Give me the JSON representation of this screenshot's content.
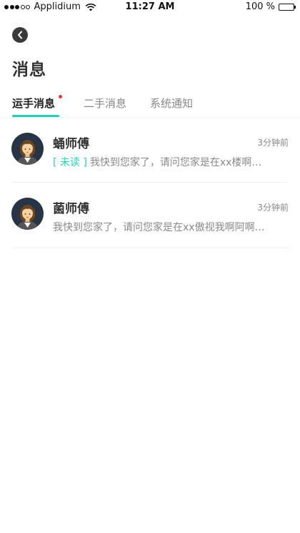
{
  "status_bar": {
    "carrier": "Applidium",
    "time": "11:27 AM",
    "battery": "100 %"
  },
  "page": {
    "title": "消息"
  },
  "tabs": [
    {
      "label": "运手消息",
      "active": true,
      "badge": true
    },
    {
      "label": "二手消息",
      "active": false
    },
    {
      "label": "系统通知",
      "active": false
    }
  ],
  "messages": [
    {
      "name": "蛹师傅",
      "time": "3分钟前",
      "unread_label": "[ 未读 ]",
      "preview": "我快到您家了，请问您家是在xx楼啊…"
    },
    {
      "name": "菌师傅",
      "time": "3分钟前",
      "preview": "我快到您家了，请问您家是在xx傲视我啊阿啊…"
    }
  ],
  "colors": {
    "accent": "#1fd0b6",
    "badge": "#e63a3a",
    "avatar_bg": "#263445"
  }
}
